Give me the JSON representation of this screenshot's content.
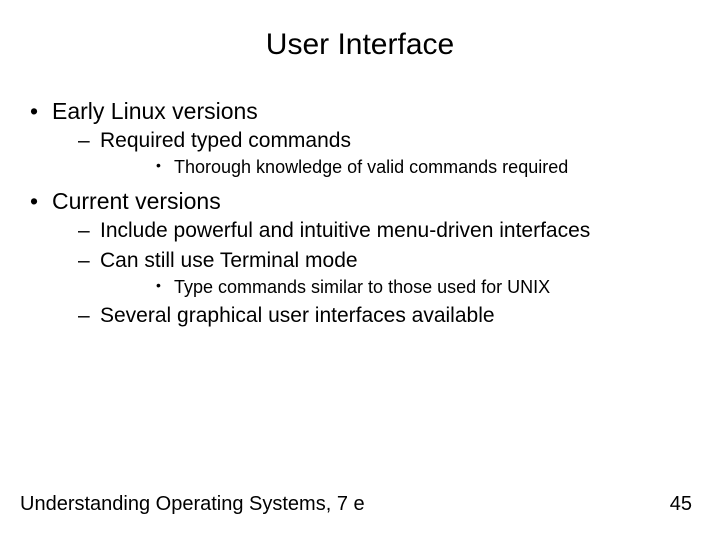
{
  "title": "User Interface",
  "bullets": {
    "b1": "Early Linux versions",
    "b1_1": "Required typed commands",
    "b1_1_1": "Thorough knowledge of valid commands required",
    "b2": " Current versions",
    "b2_1": "Include powerful and intuitive menu-driven interfaces",
    "b2_2": "Can still use Terminal mode",
    "b2_2_1": "Type commands similar to those used for UNIX",
    "b2_3": "Several graphical user interfaces available"
  },
  "footer": {
    "source": "Understanding Operating Systems, 7 e",
    "page": "45"
  }
}
